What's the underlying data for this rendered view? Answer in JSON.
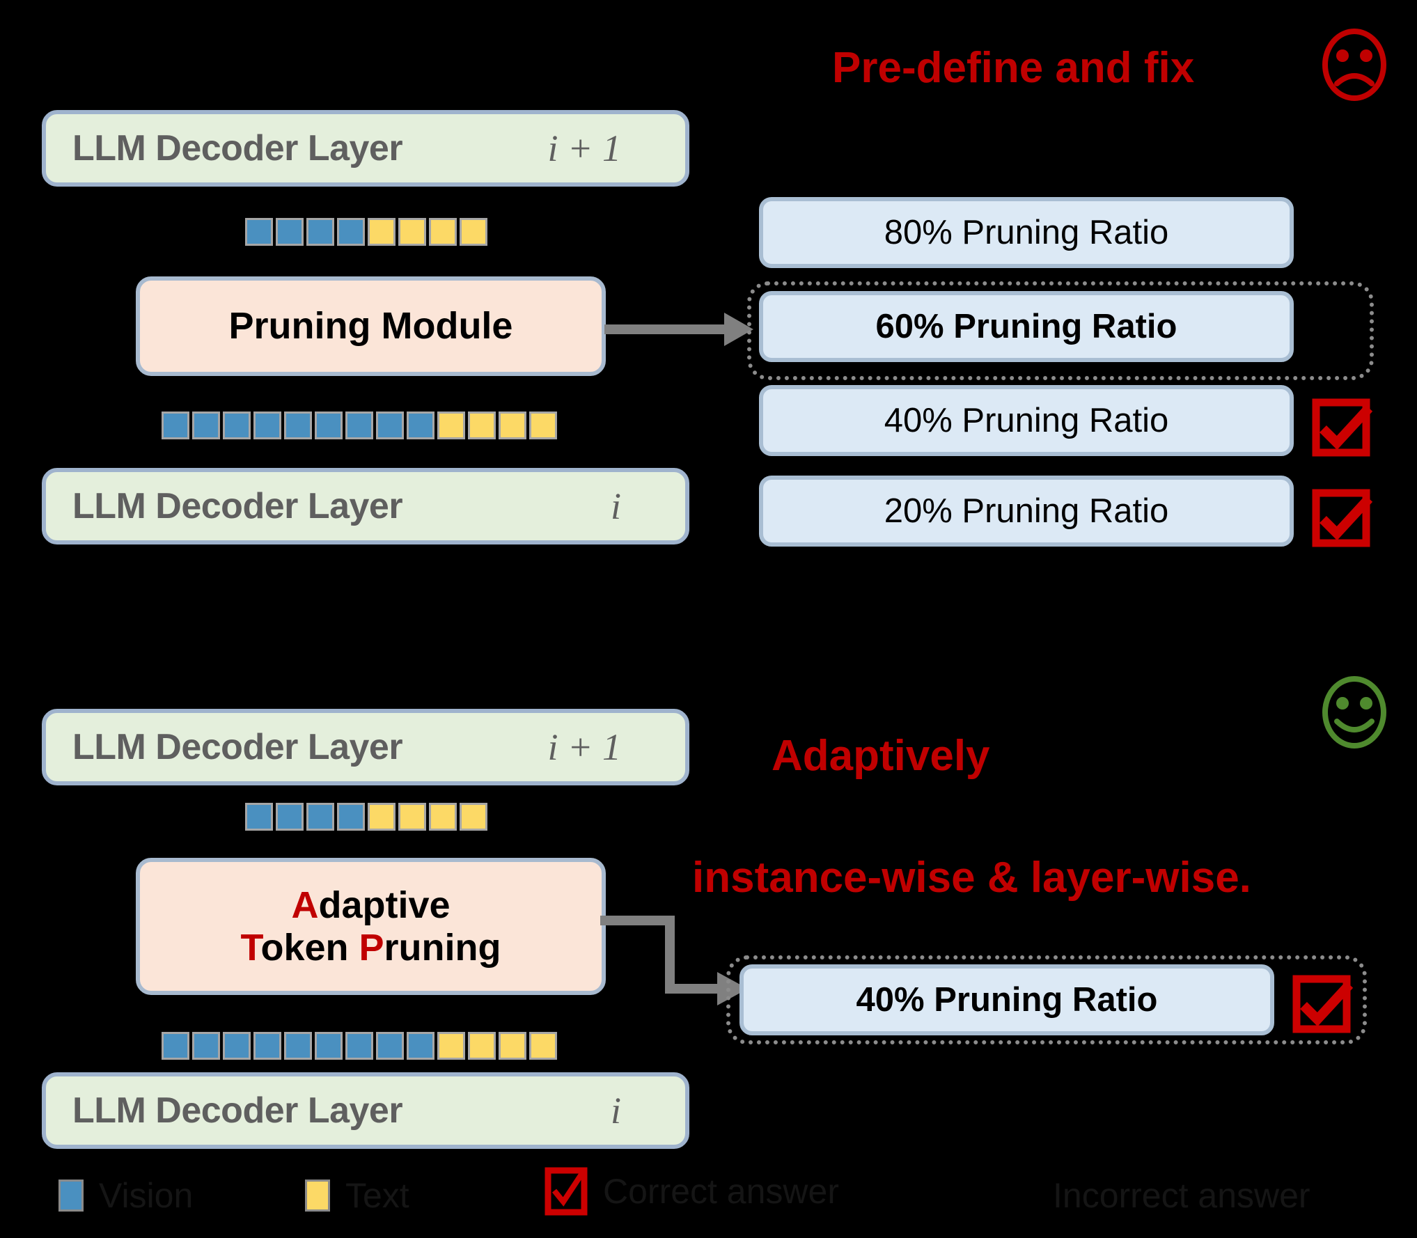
{
  "colors": {
    "background": "#000000",
    "accent_red": "#c00000",
    "accent_green": "#4f8a2e",
    "vision_token": "#4a90c0",
    "text_token": "#fcd966",
    "decoder_fill": "#e4efdc",
    "module_fill": "#fbe5d8",
    "ratio_fill": "#dce9f5",
    "box_border": "#9fb3cd",
    "arrow_gray": "#808080",
    "dotted_gray": "#8c8c8c",
    "decoder_text": "#5f5f5f"
  },
  "top_panel": {
    "headline": "Pre-define and fix",
    "mood_icon": "sad-face-icon",
    "decoder_upper": {
      "label": "LLM Decoder Layer",
      "index": "i + 1"
    },
    "decoder_lower": {
      "label": "LLM Decoder Layer",
      "index": "i"
    },
    "module": {
      "label": "Pruning Module"
    },
    "tokens_upper": {
      "vision": 4,
      "text": 4
    },
    "tokens_lower": {
      "vision": 9,
      "text": 4
    },
    "ratios": [
      {
        "label": "80% Pruning Ratio",
        "selected": false,
        "correct": false,
        "bold": false
      },
      {
        "label": "60% Pruning Ratio",
        "selected": true,
        "correct": false,
        "bold": true
      },
      {
        "label": "40% Pruning Ratio",
        "selected": false,
        "correct": true,
        "bold": false
      },
      {
        "label": "20% Pruning Ratio",
        "selected": false,
        "correct": true,
        "bold": false
      }
    ]
  },
  "bottom_panel": {
    "headline_line1": "Adaptively",
    "headline_line2": "instance-wise & layer-wise.",
    "mood_icon": "happy-face-icon",
    "decoder_upper": {
      "label": "LLM Decoder Layer",
      "index": "i + 1"
    },
    "decoder_lower": {
      "label": "LLM Decoder Layer",
      "index": "i"
    },
    "module": {
      "line1_hl": "A",
      "line1_rest": "daptive",
      "line2_hl1": "T",
      "line2_rest1": "oken ",
      "line2_hl2": "P",
      "line2_rest2": "runing"
    },
    "tokens_upper": {
      "vision": 4,
      "text": 4
    },
    "tokens_lower": {
      "vision": 9,
      "text": 4
    },
    "ratios": [
      {
        "label": "40% Pruning Ratio",
        "selected": true,
        "correct": true,
        "bold": true
      }
    ]
  },
  "legend": {
    "items": [
      {
        "kind": "vision-swatch",
        "label": "Vision"
      },
      {
        "kind": "text-swatch",
        "label": "Text"
      },
      {
        "kind": "check-icon",
        "label": "Correct answer"
      },
      {
        "kind": "blank",
        "label": "Incorrect answer"
      }
    ]
  }
}
